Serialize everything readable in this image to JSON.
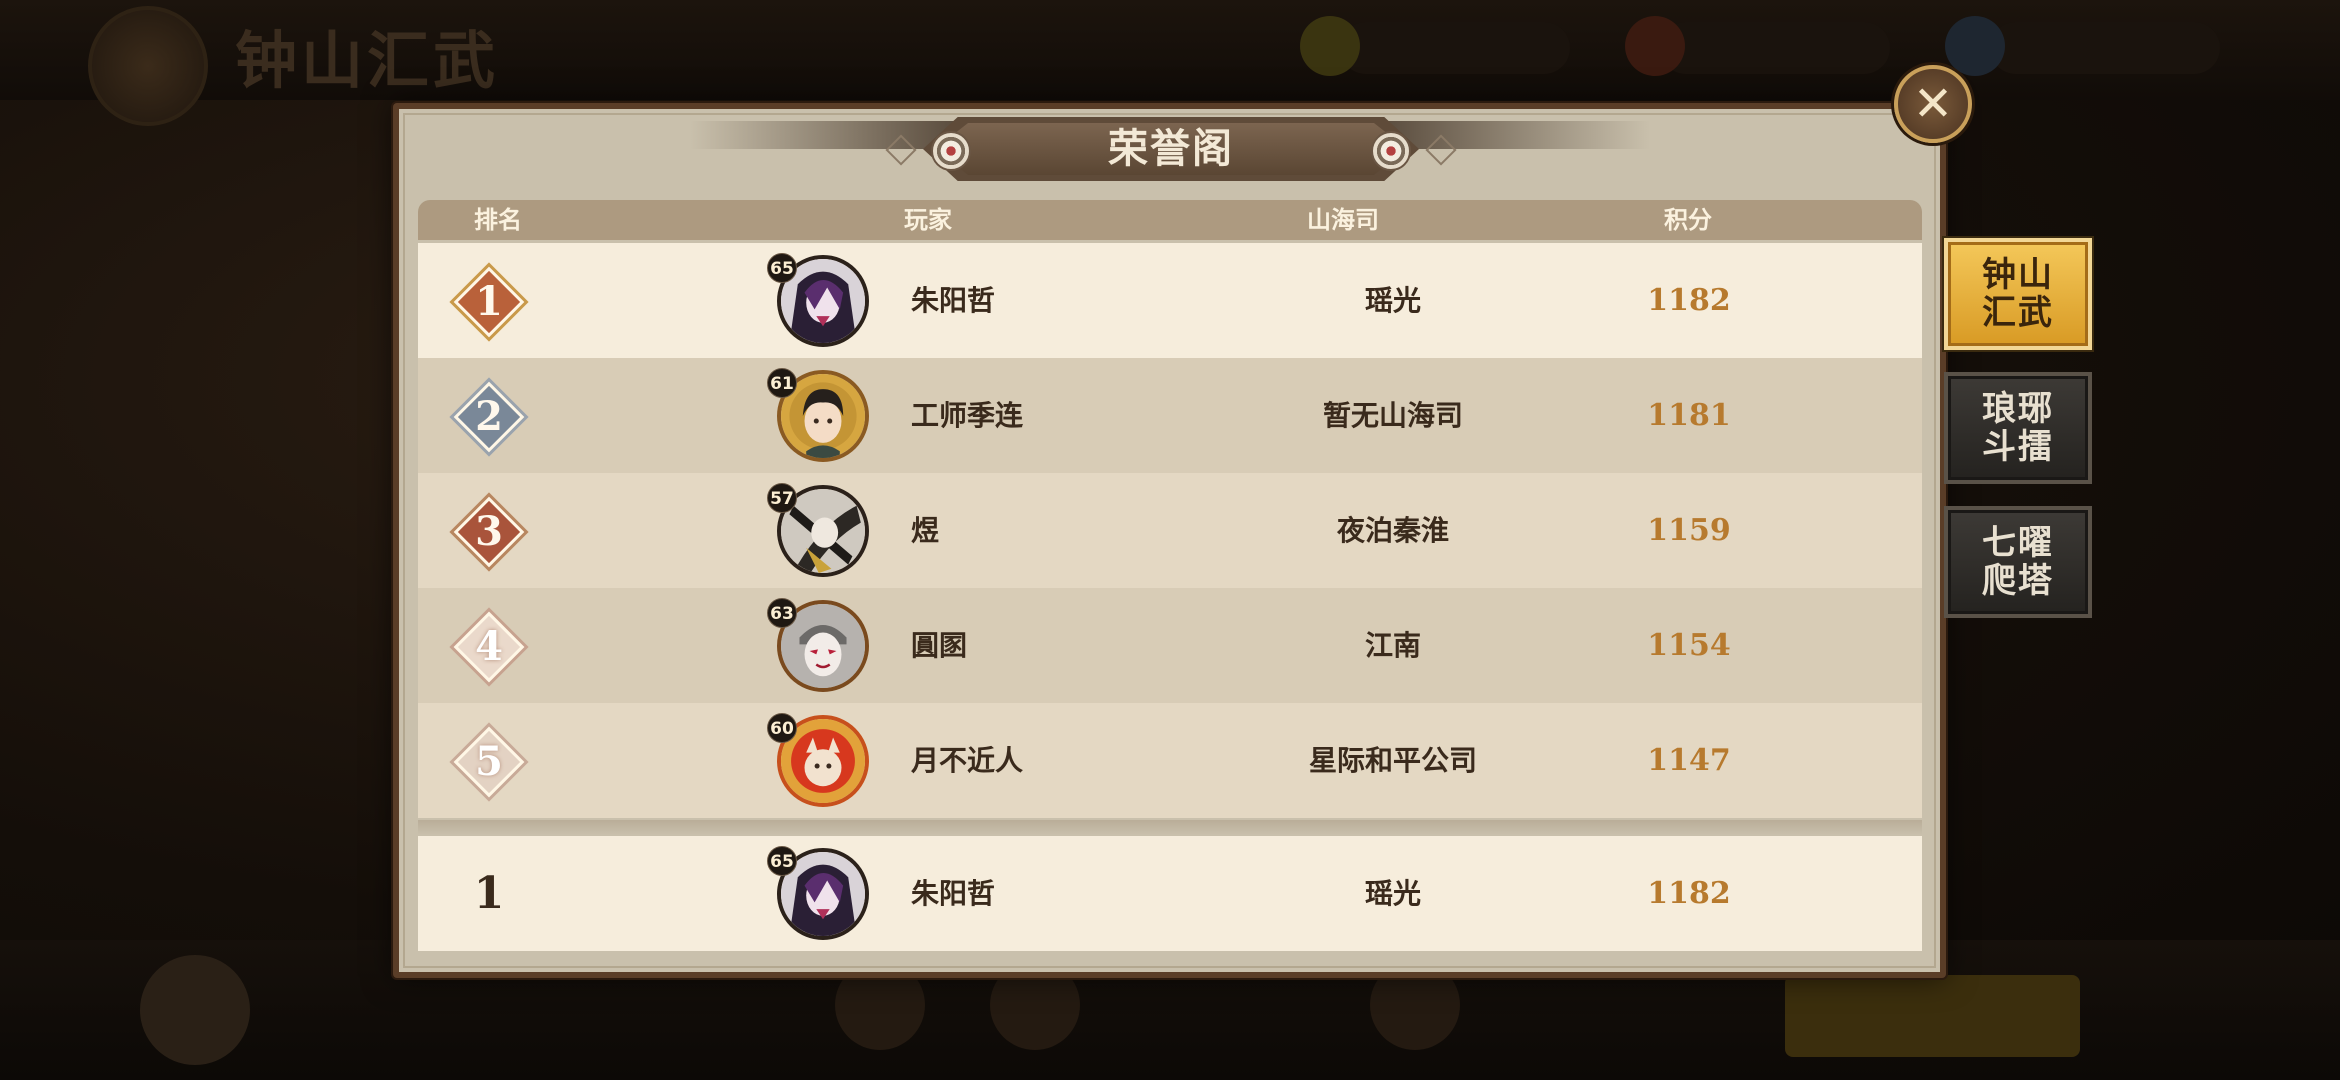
{
  "background": {
    "title": "钟山汇武"
  },
  "panel": {
    "title": "荣誉阁"
  },
  "table": {
    "headers": {
      "rank": "排名",
      "player": "玩家",
      "guild": "山海司",
      "score": "积分"
    },
    "rows": [
      {
        "rank": "1",
        "level": "65",
        "name": "朱阳哲",
        "guild": "瑶光",
        "score": "1182",
        "avatar": "purple-haired-character-avatar"
      },
      {
        "rank": "2",
        "level": "61",
        "name": "工师季连",
        "guild": "暂无山海司",
        "score": "1181",
        "avatar": "dark-haired-boy-avatar"
      },
      {
        "rank": "3",
        "level": "57",
        "name": "煜",
        "guild": "夜泊秦淮",
        "score": "1159",
        "avatar": "black-white-warrior-avatar"
      },
      {
        "rank": "4",
        "level": "63",
        "name": "圓圂",
        "guild": "江南",
        "score": "1154",
        "avatar": "masked-character-avatar"
      },
      {
        "rank": "5",
        "level": "60",
        "name": "月不近人",
        "guild": "星际和平公司",
        "score": "1147",
        "avatar": "fox-character-avatar"
      }
    ],
    "self": {
      "rank": "1",
      "level": "65",
      "name": "朱阳哲",
      "guild": "瑶光",
      "score": "1182",
      "avatar": "purple-haired-character-avatar"
    }
  },
  "side_tabs": [
    {
      "label": "钟山汇武",
      "active": true
    },
    {
      "label": "琅琊斗擂",
      "active": false
    },
    {
      "label": "七曜爬塔",
      "active": false
    }
  ],
  "colors": {
    "panel_bg": "#c9c0ac",
    "header_bg": "#ad9a80",
    "score_color": "#b77a2e",
    "active_tab": "#e6ad3a"
  }
}
